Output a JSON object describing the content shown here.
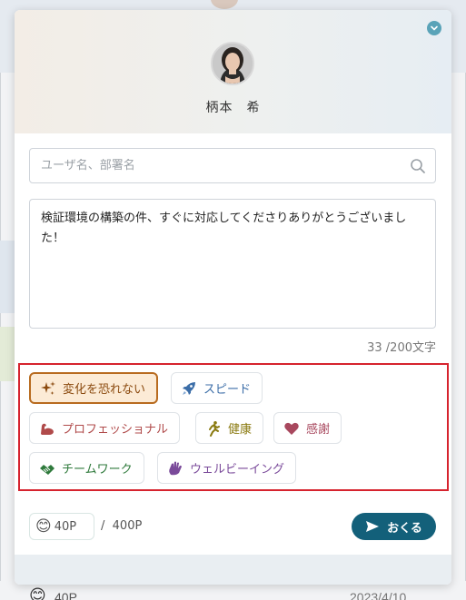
{
  "modal": {
    "recipient_name": "柄本　希"
  },
  "search": {
    "placeholder": "ユーザ名、部署名",
    "value": ""
  },
  "message": {
    "text": "検証環境の構築の件、すぐに対応してくださりありがとうございました！",
    "char_count": "33 /200文字"
  },
  "tags": [
    {
      "label": "変化を恐れない",
      "icon": "sparkle-icon",
      "color": "#8b4a0f",
      "selected": true
    },
    {
      "label": "スピード",
      "icon": "rocket-icon",
      "color": "#3c6ea8",
      "selected": false
    },
    {
      "label": "プロフェッショナル",
      "icon": "muscle-arm-icon",
      "color": "#b04a4a",
      "selected": false
    },
    {
      "label": "健康",
      "icon": "runner-icon",
      "color": "#8a7a10",
      "selected": false
    },
    {
      "label": "感謝",
      "icon": "heart-icon",
      "color": "#a8485e",
      "selected": false
    },
    {
      "label": "チームワーク",
      "icon": "handshake-icon",
      "color": "#2f7a3c",
      "selected": false
    },
    {
      "label": "ウェルビーイング",
      "icon": "wave-hand-icon",
      "color": "#7a4a9a",
      "selected": false
    }
  ],
  "points": {
    "emoji": "😊",
    "value": "40P",
    "separator": "/",
    "max": "400P"
  },
  "send_button": {
    "label": "おくる"
  },
  "background": {
    "row_emoji": "😊",
    "row_points": "40P",
    "row_date": "2023/4/10"
  },
  "colors": {
    "accent": "#13607a",
    "highlight_border": "#d6232e",
    "selected_tag_bg": "#fcebd6",
    "selected_tag_border": "#b86b1f"
  }
}
